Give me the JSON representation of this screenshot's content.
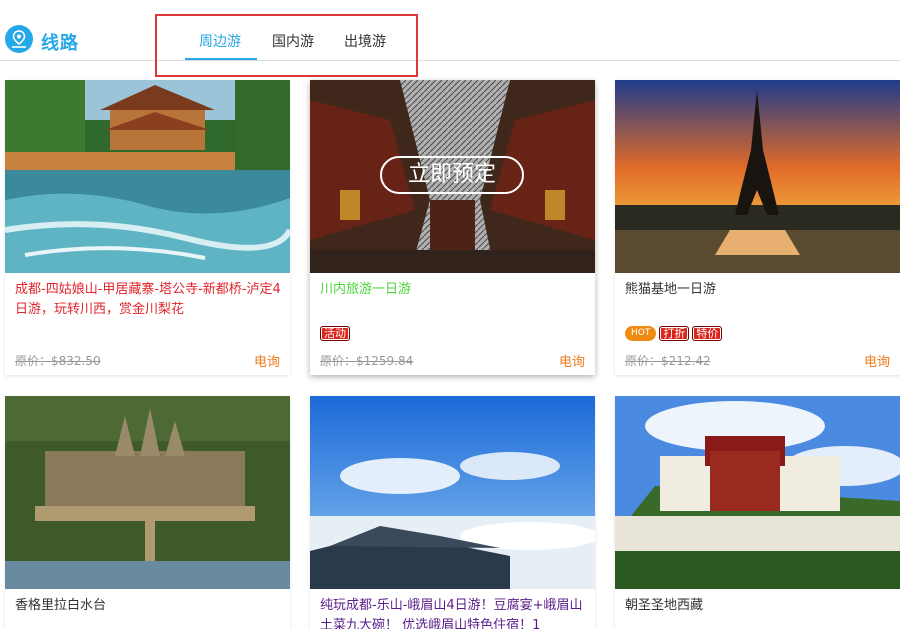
{
  "header": {
    "title": "线路",
    "icon": "route-icon",
    "tabs": [
      {
        "label": "周边游",
        "active": true
      },
      {
        "label": "国内游",
        "active": false
      },
      {
        "label": "出境游",
        "active": false
      }
    ]
  },
  "cards": [
    {
      "title": "成都-四姑娘山-甲居藏寨-塔公寺-新都桥-泸定4日游，玩转川西，赏金川梨花",
      "tags": [],
      "orig_label": "原价：",
      "price": "$832.50",
      "inquire": "电询"
    },
    {
      "title": "川内旅游一日游",
      "tags": [
        "活动"
      ],
      "orig_label": "原价：",
      "price": "$1259.84",
      "inquire": "电询",
      "overlay": "立即预定"
    },
    {
      "title": "熊猫基地一日游",
      "tags": [
        "HOT",
        "打折",
        "特价"
      ],
      "orig_label": "原价：",
      "price": "$212.42",
      "inquire": "电询"
    },
    {
      "title": "香格里拉白水台"
    },
    {
      "title": "纯玩成都-乐山-峨眉山4日游！豆腐宴+峨眉山土菜九大碗！ 优选峨眉山特色住宿！1"
    },
    {
      "title": "朝圣圣地西藏"
    }
  ],
  "colors": {
    "accent": "#25a8e8",
    "red_title": "#e0252c",
    "green_title": "#4cd33a",
    "inquire": "#ef7a1a",
    "highlight_box": "#e0363a"
  }
}
